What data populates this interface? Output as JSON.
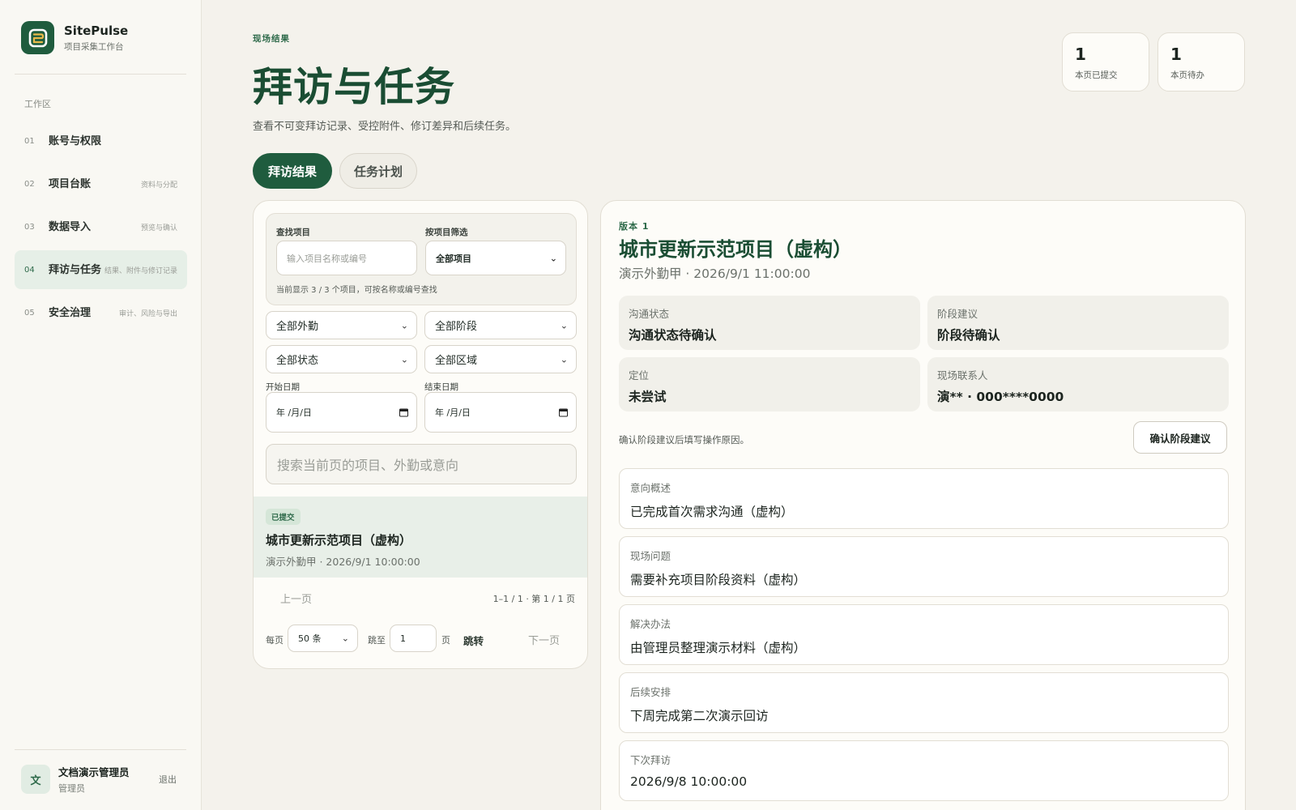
{
  "app": {
    "name": "SitePulse",
    "subtitle": "项目采集工作台"
  },
  "sidebar": {
    "section": "工作区",
    "items": [
      {
        "num": "01",
        "label": "账号与权限",
        "hint": ""
      },
      {
        "num": "02",
        "label": "项目台账",
        "hint": "资料与分配"
      },
      {
        "num": "03",
        "label": "数据导入",
        "hint": "预览与确认"
      },
      {
        "num": "04",
        "label": "拜访与任务",
        "hint": "结果、附件与修订记录",
        "active": true
      },
      {
        "num": "05",
        "label": "安全治理",
        "hint": "审计、风险与导出"
      }
    ],
    "user": {
      "avatar": "文",
      "name": "文档演示管理员",
      "role": "管理员",
      "logout": "退出"
    }
  },
  "header": {
    "eyebrow": "现场结果",
    "title": "拜访与任务",
    "description": "查看不可变拜访记录、受控附件、修订差异和后续任务。",
    "stats": [
      {
        "value": "1",
        "label": "本页已提交"
      },
      {
        "value": "1",
        "label": "本页待办"
      }
    ]
  },
  "tabs": [
    {
      "label": "拜访结果",
      "active": true
    },
    {
      "label": "任务计划",
      "active": false
    }
  ],
  "filters": {
    "find_label": "查找项目",
    "find_placeholder": "输入项目名称或编号",
    "project_filter_label": "按项目筛选",
    "project_filter_value": "全部项目",
    "count_hint": "当前显示 3 / 3 个项目，可按名称或编号查找",
    "field_staff": "全部外勤",
    "stage": "全部阶段",
    "status": "全部状态",
    "region": "全部区域",
    "start_date_label": "开始日期",
    "end_date_label": "结束日期",
    "date_placeholder": "年 /月/日",
    "search_placeholder": "搜索当前页的项目、外勤或意向"
  },
  "list": {
    "rows": [
      {
        "badge": "已提交",
        "title": "城市更新示范项目（虚构）",
        "meta": "演示外勤甲 · 2026/9/1 10:00:00"
      }
    ]
  },
  "pager": {
    "prev": "上一页",
    "info": "1–1 / 1 · 第 1 / 1 页",
    "per_page_label": "每页",
    "per_page_value": "50 条",
    "jump_label": "跳至",
    "jump_value": "1",
    "page_unit": "页",
    "jump_button": "跳转",
    "next": "下一页"
  },
  "detail": {
    "version": "版本 1",
    "title": "城市更新示范项目（虚构）",
    "meta": "演示外勤甲 · 2026/9/1 11:00:00",
    "info": [
      {
        "label": "沟通状态",
        "value": "沟通状态待确认"
      },
      {
        "label": "阶段建议",
        "value": "阶段待确认"
      },
      {
        "label": "定位",
        "value": "未尝试"
      },
      {
        "label": "现场联系人",
        "value": "演** · 000****0000"
      }
    ],
    "note": "确认阶段建议后填写操作原因。",
    "confirm_button": "确认阶段建议",
    "sections": [
      {
        "label": "意向概述",
        "value": "已完成首次需求沟通（虚构）"
      },
      {
        "label": "现场问题",
        "value": "需要补充项目阶段资料（虚构）"
      },
      {
        "label": "解决办法",
        "value": "由管理员整理演示材料（虚构）"
      },
      {
        "label": "后续安排",
        "value": "下周完成第二次演示回访"
      },
      {
        "label": "下次拜访",
        "value": "2026/9/8 10:00:00"
      }
    ]
  }
}
